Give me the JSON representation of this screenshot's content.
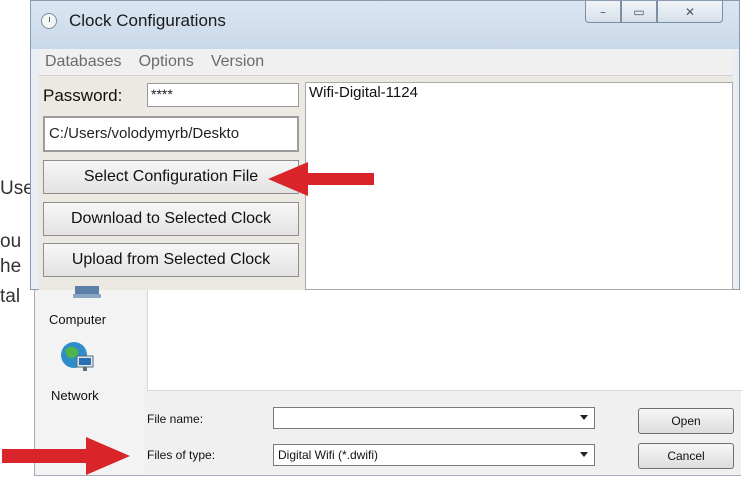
{
  "background_text": [
    "Use",
    "ou",
    "he",
    "tal"
  ],
  "window": {
    "title": "Clock Configurations",
    "controls": {
      "minimize": "–",
      "maximize": "▭",
      "close": "✕"
    }
  },
  "menu": [
    "Databases",
    "Options",
    "Version"
  ],
  "form": {
    "password_label": "Password:",
    "password_value": "****",
    "path_value": "C:/Users/volodymyrb/Deskto",
    "buttons": {
      "select_config": "Select Configuration File",
      "download": "Download to Selected Clock",
      "upload": "Upload from Selected Clock"
    }
  },
  "clock_list": [
    "Wifi-Digital-1124"
  ],
  "file_dialog": {
    "nav": [
      "Computer",
      "Network"
    ],
    "file_name_label": "File name:",
    "file_name_value": "",
    "file_type_label": "Files of type:",
    "file_type_value": "Digital Wifi (*.dwifi)",
    "open_label": "Open",
    "cancel_label": "Cancel"
  },
  "colors": {
    "arrow": "#d9252a",
    "window_frame": "#c9d8e9"
  }
}
